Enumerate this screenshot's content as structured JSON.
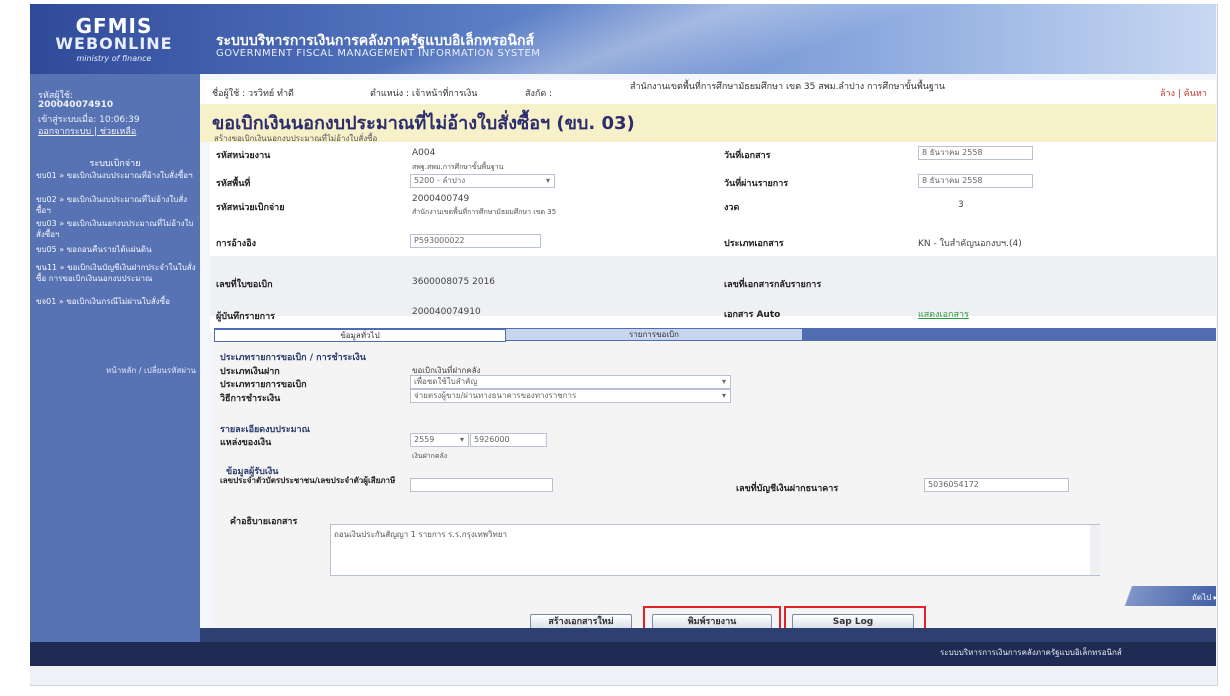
{
  "header": {
    "logo_line1": "GFMIS",
    "logo_line2": "WEBONLINE",
    "logo_line3": "ministry of finance",
    "system_th": "ระบบบริหารการเงินการคลังภาครัฐแบบอิเล็กทรอนิกส์",
    "system_en": "GOVERNMENT FISCAL MANAGEMENT INFORMATION SYSTEM"
  },
  "sidebar": {
    "user_label": "รหัสผู้ใช้:",
    "user_id": "200040074910",
    "login_time_label": "เข้าสู่ระบบเมื่อ: 10:06:39",
    "links": "ออกจากระบบ | ช่วยเหลือ",
    "menu_title": "ระบบเบิกจ่าย",
    "items": [
      "ขบ01 » ขอเบิกเงินงบประมาณที่อ้างใบสั่งซื้อฯ",
      "ขบ02 » ขอเบิกเงินงบประมาณที่ไม่อ้างใบสั่งซื้อฯ",
      "ขบ03 » ขอเบิกเงินนอกงบประมาณที่ไม่อ้างใบสั่งซื้อฯ",
      "ขบ05 » ขอถอนคืนรายได้แผ่นดิน",
      "ขน11 » ขอเบิกเงินบัญชีเงินฝากประจำในใบสั่งซื้อ การขอเบิกเงินนอกงบประมาณ",
      "ขจ01 » ขอเบิกเงินกรณีไม่ผ่านใบสั่งซื้อ"
    ],
    "footer": "หน้าหลัก / เปลี่ยนรหัสผ่าน"
  },
  "infobar": {
    "user": "ชื่อผู้ใช้ : วรวิทย์ ทำดี",
    "dept": "ตำแหน่ง : เจ้าหน้าที่การเงิน",
    "unit": "สังกัด :",
    "org": "สำนักงานเขตพื้นที่การศึกษามัธยมศึกษา เขต 35 สพม.ลำปาง การศึกษาขั้นพื้นฐาน",
    "right": "ล้าง | ค้นหา"
  },
  "page": {
    "title": "ขอเบิกเงินนอกงบประมาณที่ไม่อ้างใบสั่งซื้อฯ (ขบ. 03)",
    "subtitle": "สร้างขอเบิกเงินนอกงบประมาณที่ไม่อ้างใบสั่งซื้อ"
  },
  "form": {
    "agency_code_label": "รหัสหน่วยงาน",
    "agency_code": "A004",
    "agency_name": "สพฐ.สพม.การศึกษาขั้นพื้นฐาน",
    "doc_date_label": "วันที่เอกสาร",
    "doc_date": "8 ธันวาคม 2558",
    "area_code_label": "รหัสพื้นที่",
    "area_code": "5200 - ลำปาง",
    "post_date_label": "วันที่ผ่านรายการ",
    "post_date": "8 ธันวาคม 2558",
    "disb_unit_label": "รหัสหน่วยเบิกจ่าย",
    "disb_unit": "2000400749",
    "disb_unit_name": "สำนักงานเขตพื้นที่การศึกษามัธยมศึกษา เขต 35",
    "period_label": "งวด",
    "period": "3",
    "ref_label": "การอ้างอิง",
    "ref": "P593000022",
    "doc_type_label": "ประเภทเอกสาร",
    "doc_type": "KN - ใบสำคัญนอกงบฯ.(4)",
    "req_no_label": "เลขที่ใบขอเบิก",
    "req_no": "3600008075  2016",
    "cancel_doc_label": "เลขที่เอกสารกลับรายการ",
    "recorder_label": "ผู้บันทึกรายการ",
    "recorder": "200040074910",
    "auto_label": "เอกสาร Auto",
    "auto_link": "แสดงเอกสาร"
  },
  "tabs": {
    "general": "ข้อมูลทั่วไป",
    "detail": "รายการขอเบิก"
  },
  "lower": {
    "section1": "ประเภทรายการขอเบิก / การชำระเงิน",
    "pay_type_label": "ประเภทเงินฝาก",
    "pay_type": "ขอเบิกเงินที่ฝากคลัง",
    "item_type_label": "ประเภทรายการขอเบิก",
    "item_type": "เพื่อชดใช้ใบสำคัญ",
    "pay_method_label": "วิธีการชำระเงิน",
    "pay_method": "จ่ายตรงผู้ขาย/ผ่านทางธนาคารของทางราชการ",
    "section2": "รายละเอียดงบประมาณ",
    "source_label": "แหล่งของเงิน",
    "source_year": "2559",
    "source_code": "5926000",
    "source_note": "เงินฝากคลัง",
    "section3": "ข้อมูลผู้รับเงิน",
    "taxid_label": "เลขประจำตัวบัตรประชาชน/เลขประจำตัวผู้เสียภาษี",
    "bank_label": "เลขที่บัญชีเงินฝากธนาคาร",
    "bank_no": "5036054172",
    "desc_label": "คำอธิบายเอกสาร",
    "desc": "ถอนเงินประกันสัญญา 1 รายการ  ร.ร.กรุงเทพวิทยา",
    "next": "ถัดไป ▸"
  },
  "buttons": {
    "new_doc": "สร้างเอกสารใหม่",
    "print": "พิมพ์รายงาน",
    "sap_log": "Sap Log"
  },
  "footer": {
    "text": "ระบบบริหารการเงินการคลังภาครัฐแบบอิเล็กทรอนิกส์"
  },
  "colors": {
    "highlight": "#e0232a",
    "sidebar": "#5873b3",
    "tab_bar": "#4f6db0"
  }
}
